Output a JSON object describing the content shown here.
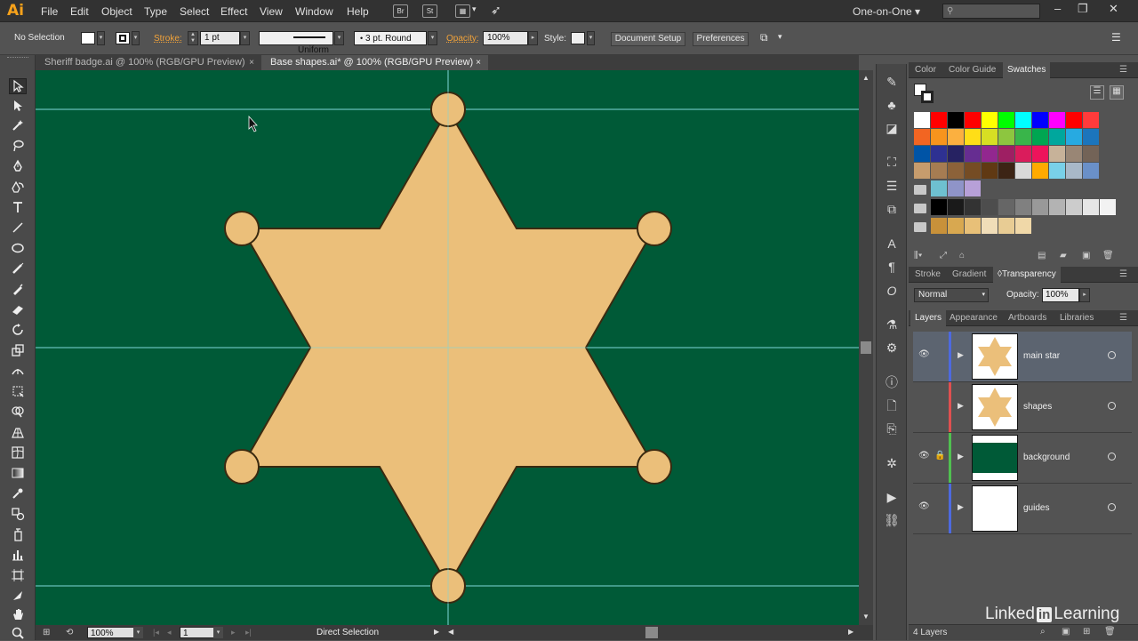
{
  "app": {
    "logo": "Ai",
    "workspace": "One-on-One",
    "workspace_arrow": "▾"
  },
  "menu": [
    "File",
    "Edit",
    "Object",
    "Type",
    "Select",
    "Effect",
    "View",
    "Window",
    "Help"
  ],
  "menubar_icons": {
    "bridge": "Br",
    "stock": "St"
  },
  "control": {
    "selection": "No Selection",
    "stroke_label": "Stroke:",
    "stroke_weight": "1 pt",
    "profile": "Uniform",
    "brush": "3 pt. Round",
    "opacity_label": "Opacity:",
    "opacity": "100%",
    "style_label": "Style:",
    "doc_setup": "Document Setup",
    "preferences": "Preferences"
  },
  "tabs": [
    {
      "label": "Sheriff badge.ai @ 100% (RGB/GPU Preview)",
      "close": "×",
      "active": false
    },
    {
      "label": "Base shapes.ai* @ 100% (RGB/GPU Preview)",
      "close": "×",
      "active": true
    }
  ],
  "statusbar": {
    "zoom": "100%",
    "artboard": "1",
    "tool": "Direct Selection"
  },
  "panels": {
    "top_tabs": [
      "Color",
      "Color Guide",
      "Swatches"
    ],
    "mid_tabs": [
      "Stroke",
      "Gradient",
      "Transparency"
    ],
    "blend_mode": "Normal",
    "opacity_label": "Opacity:",
    "opacity": "100%",
    "bottom_tabs": [
      "Layers",
      "Appearance",
      "Artboards",
      "Libraries"
    ],
    "layers_count": "4 Layers"
  },
  "swatches": {
    "row1": [
      "#ffffff",
      "#ff0000",
      "#000000",
      "#ff0000",
      "#ffff00",
      "#00ff00",
      "#00ffff",
      "#0000ff",
      "#ff00ff",
      "#ff0000",
      "#ff3b3b"
    ],
    "row2": [
      "#f26522",
      "#f7941d",
      "#fbb040",
      "#ffde17",
      "#d7df23",
      "#8dc63f",
      "#39b54a",
      "#00a651",
      "#00a79d",
      "#27aae1",
      "#1c75bc"
    ],
    "row3": [
      "#0054a6",
      "#2e3192",
      "#262262",
      "#662d91",
      "#92278f",
      "#9e1f63",
      "#da1c5c",
      "#ed145b",
      "#c7b299",
      "#998675",
      "#736357"
    ],
    "row4": [
      "#c69c6d",
      "#a67c52",
      "#8c6239",
      "#754c24",
      "#603913",
      "#3c2415",
      "#d9d9d9",
      "#ffaa00",
      "#79d0e8",
      "#a8b8c8",
      "#6a90c8"
    ],
    "row5": [
      "#6ec0d0",
      "#8f94c8",
      "#b7a0d8"
    ],
    "row6": [
      "#000000",
      "#1a1a1a",
      "#333333",
      "#4d4d4d",
      "#666666",
      "#808080",
      "#999999",
      "#b3b3b3",
      "#cccccc",
      "#e6e6e6",
      "#f2f2f2"
    ],
    "row7": [
      "#c8913a",
      "#d8a850",
      "#e8c078",
      "#f0ddb8",
      "#e8cc94",
      "#f0d8a8"
    ]
  },
  "layers": [
    {
      "name": "main star",
      "color": "#4d6ae0",
      "visible": true,
      "locked": false,
      "thumb": "star",
      "selected": true
    },
    {
      "name": "shapes",
      "color": "#e05050",
      "visible": false,
      "locked": false,
      "thumb": "star",
      "selected": false
    },
    {
      "name": "background",
      "color": "#50c050",
      "visible": true,
      "locked": true,
      "thumb": "bg",
      "selected": false
    },
    {
      "name": "guides",
      "color": "#4d6ae0",
      "visible": true,
      "locked": false,
      "thumb": "blank",
      "selected": false
    }
  ],
  "watermark": {
    "pre": "Linked",
    "in": "in",
    "post": "Learning"
  },
  "colors": {
    "canvas": "#005a37",
    "star_fill": "#ebbf7a",
    "star_stroke": "#3a2a10",
    "guide": "#7fd8d8"
  }
}
